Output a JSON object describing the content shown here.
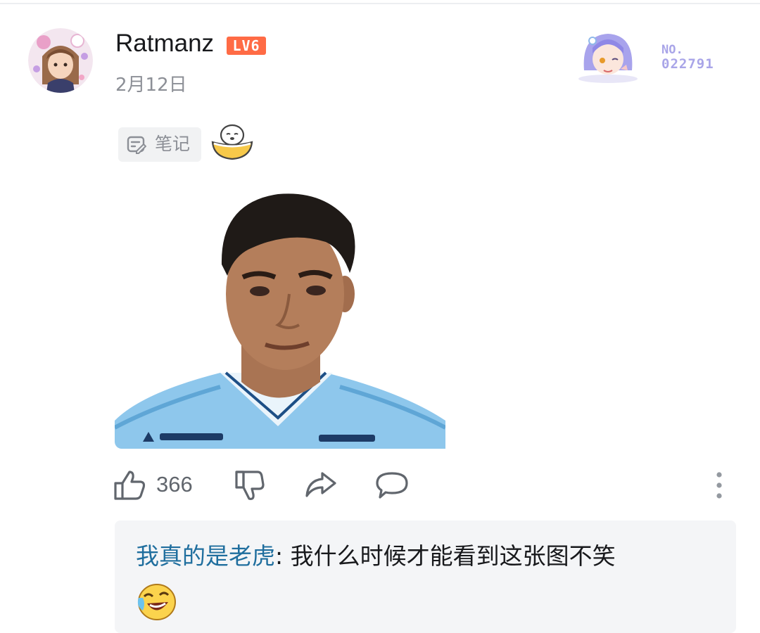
{
  "post": {
    "username": "Ratmanz",
    "level": "LV6",
    "date": "2月12日",
    "fan_badge": {
      "label": "NO.",
      "number": "022791"
    },
    "tag": {
      "label": "笔记",
      "icon": "note-icon"
    },
    "reaction_emoji": "bowl-emoji-icon",
    "image": "portrait-photo"
  },
  "actions": {
    "like_count": "366",
    "like_icon": "thumbs-up-icon",
    "dislike_icon": "thumbs-down-icon",
    "share_icon": "share-icon",
    "comment_icon": "comment-icon",
    "more_icon": "more-vertical-icon"
  },
  "comment_preview": {
    "author": "我真的是老虎",
    "separator": ": ",
    "text": "我什么时候才能看到这张图不笑",
    "emoji": "laughing-crying-emoji-icon"
  },
  "colors": {
    "level_badge": "#ff6b45",
    "comment_author": "#1f6e9e",
    "fan_number": "#a9a5e8",
    "comment_bg": "#f4f5f7"
  }
}
